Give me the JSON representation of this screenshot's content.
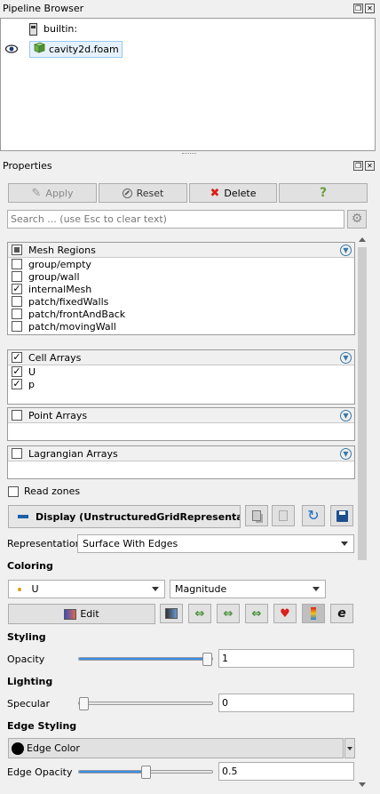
{
  "pipeline": {
    "title": "Pipeline Browser",
    "items": [
      {
        "label": "builtin:"
      },
      {
        "label": "cavity2d.foam"
      }
    ]
  },
  "properties": {
    "title": "Properties",
    "buttons": {
      "apply": "Apply",
      "reset": "Reset",
      "delete": "Delete",
      "help": "?"
    },
    "search_placeholder": "Search ... (use Esc to clear text)",
    "mesh_regions": {
      "header": "Mesh Regions",
      "items": [
        {
          "label": "group/empty",
          "checked": false
        },
        {
          "label": "group/wall",
          "checked": false
        },
        {
          "label": "internalMesh",
          "checked": true
        },
        {
          "label": "patch/fixedWalls",
          "checked": false
        },
        {
          "label": "patch/frontAndBack",
          "checked": false
        },
        {
          "label": "patch/movingWall",
          "checked": false
        }
      ]
    },
    "cell_arrays": {
      "header": "Cell Arrays",
      "items": [
        {
          "label": "U",
          "checked": true
        },
        {
          "label": "p",
          "checked": true
        }
      ]
    },
    "point_arrays": {
      "header": "Point Arrays"
    },
    "lagrangian_arrays": {
      "header": "Lagrangian Arrays"
    },
    "read_zones": "Read zones",
    "display": {
      "title": "Display (UnstructuredGridRepresentati",
      "representation_label": "Representation",
      "representation_value": "Surface With Edges",
      "coloring_label": "Coloring",
      "color_by": "U",
      "component": "Magnitude",
      "edit_label": "Edit"
    },
    "styling": {
      "label": "Styling",
      "opacity_label": "Opacity",
      "opacity_value": "1",
      "opacity_fraction": 1.0
    },
    "lighting": {
      "label": "Lighting",
      "specular_label": "Specular",
      "specular_value": "0",
      "specular_fraction": 0.0
    },
    "edge_styling": {
      "label": "Edge Styling",
      "edge_color_label": "Edge Color",
      "edge_opacity_label": "Edge Opacity",
      "edge_opacity_value": "0.5",
      "edge_opacity_fraction": 0.5
    }
  },
  "colors": {
    "accent": "#3a8ee6",
    "delete": "#d9201a",
    "cube": "#6ab04c"
  }
}
